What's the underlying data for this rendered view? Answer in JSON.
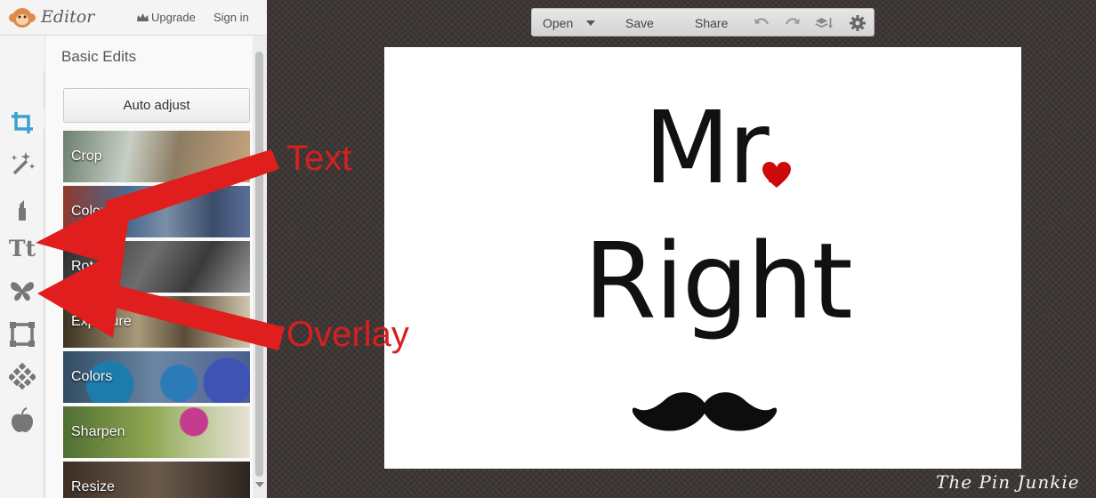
{
  "header": {
    "app_title": "Editor",
    "upgrade_label": "Upgrade",
    "signin_label": "Sign in"
  },
  "tools": [
    {
      "name": "crop-tool",
      "icon": "crop-icon",
      "selected": true
    },
    {
      "name": "effects-tool",
      "icon": "magic-wand-icon"
    },
    {
      "name": "touch-up-tool",
      "icon": "lipstick-icon"
    },
    {
      "name": "text-tool",
      "icon": "text-icon",
      "label": "Tt"
    },
    {
      "name": "overlay-tool",
      "icon": "butterfly-icon"
    },
    {
      "name": "frames-tool",
      "icon": "frame-icon"
    },
    {
      "name": "textures-tool",
      "icon": "texture-icon"
    },
    {
      "name": "seasonal-tool",
      "icon": "apple-icon"
    }
  ],
  "panel": {
    "heading": "Basic Edits",
    "auto_adjust_label": "Auto adjust",
    "tiles": [
      {
        "label": "Crop"
      },
      {
        "label": "Color"
      },
      {
        "label": "Rotate"
      },
      {
        "label": "Exposure"
      },
      {
        "label": "Colors"
      },
      {
        "label": "Sharpen"
      },
      {
        "label": "Resize"
      }
    ]
  },
  "toolbar": {
    "open_label": "Open",
    "save_label": "Save",
    "share_label": "Share",
    "icons": [
      "undo-icon",
      "redo-icon",
      "layers-icon",
      "gear-icon"
    ]
  },
  "canvas": {
    "line1": "Mr.",
    "line2": "Right",
    "decorations": [
      "heart-icon",
      "mustache-icon"
    ]
  },
  "annotations": {
    "text_label": "Text",
    "overlay_label": "Overlay"
  },
  "watermark": "The Pin Junkie",
  "colors": {
    "annotation": "#d62020",
    "heart": "#cc0a0a",
    "background": "#3d3835"
  }
}
